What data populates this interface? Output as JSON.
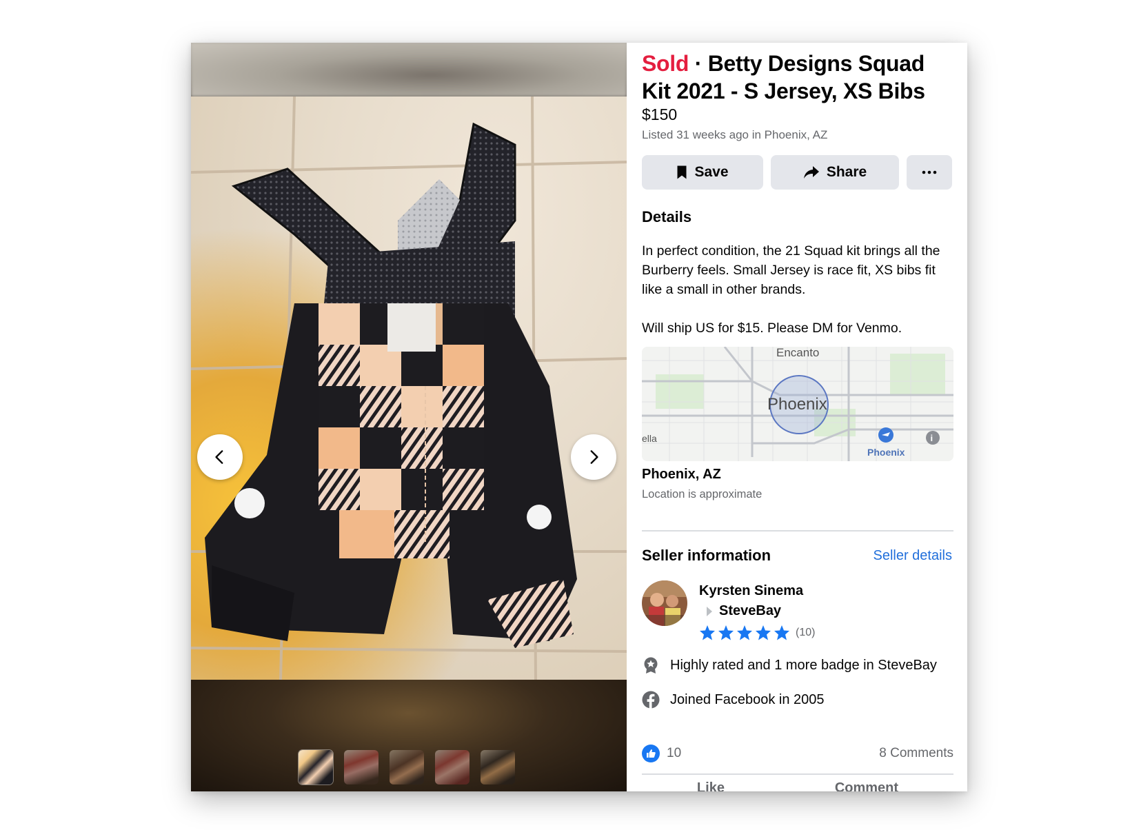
{
  "listing": {
    "status": "Sold",
    "separator": "·",
    "title": "Betty Designs Squad Kit 2021 - S Jersey, XS Bibs",
    "price": "$150",
    "listed": "Listed 31 weeks ago in Phoenix, AZ"
  },
  "actions": {
    "save_label": "Save",
    "share_label": "Share",
    "more_label": "···"
  },
  "details": {
    "heading": "Details",
    "paragraphs": [
      "In perfect condition, the 21 Squad kit brings all the Burberry feels. Small Jersey is race fit, XS bibs fit like a small in other brands.",
      "Will ship US for $15. Please DM for Venmo."
    ]
  },
  "map": {
    "labels": [
      "Encanto",
      "Phoenix",
      "ella",
      "Phoenix"
    ]
  },
  "location": {
    "name": "Phoenix, AZ",
    "note": "Location is approximate"
  },
  "seller": {
    "heading": "Seller information",
    "details_link": "Seller details",
    "name": "Kyrsten Sinema",
    "group": "SteveBay",
    "rating_stars": 5,
    "rating_count": "(10)",
    "badge_text": "Highly rated and 1 more badge in SteveBay",
    "joined_text": "Joined Facebook in 2005"
  },
  "engagement": {
    "likes": "10",
    "comments": "8 Comments",
    "like_action": "Like",
    "comment_action": "Comment"
  },
  "gallery": {
    "thumbnail_count": 5,
    "active_index": 0
  },
  "colors": {
    "sold": "#e41e3f",
    "link": "#216fdb",
    "button_bg": "#e4e6eb",
    "star": "#1877f2",
    "secondary_text": "#65676b"
  },
  "icons": {
    "prev": "chevron-left-icon",
    "next": "chevron-right-icon",
    "save": "bookmark-icon",
    "share": "share-arrow-icon",
    "more": "ellipsis-icon",
    "badge": "badge-icon",
    "joined": "facebook-icon",
    "like": "thumbs-up-icon"
  }
}
